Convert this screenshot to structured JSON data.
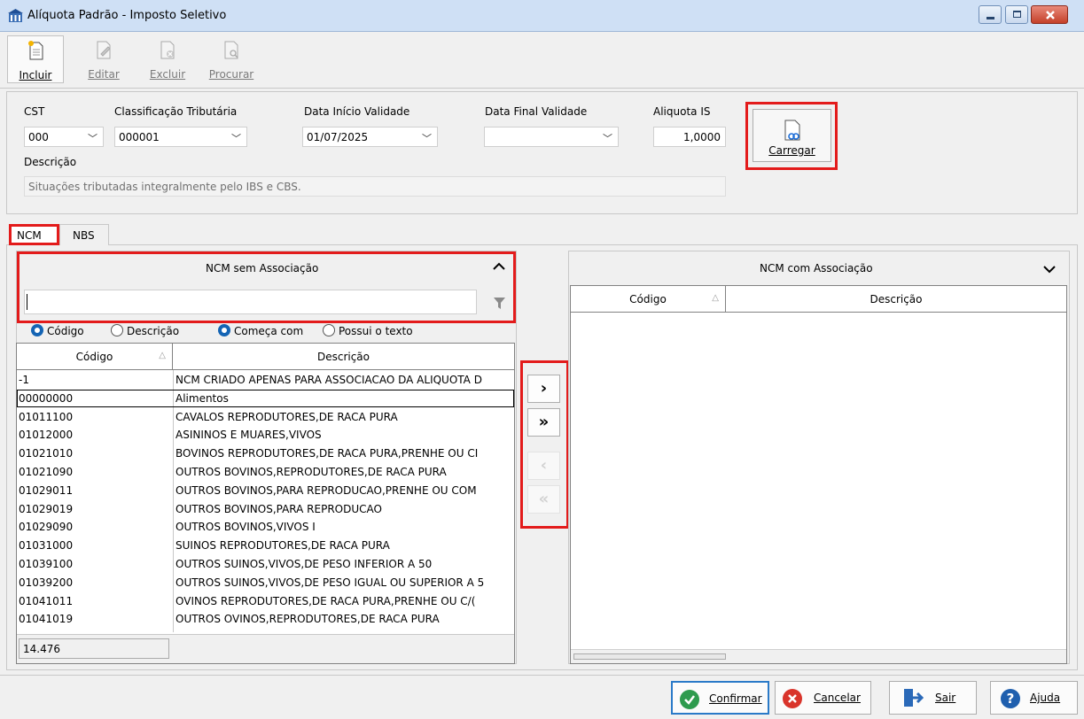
{
  "window": {
    "title": "Alíquota Padrão - Imposto Seletivo"
  },
  "toolbar": {
    "incluir": "Incluir",
    "editar": "Editar",
    "excluir": "Excluir",
    "procurar": "Procurar"
  },
  "form": {
    "cst_label": "CST",
    "cst_value": "000",
    "class_label": "Classificação Tributária",
    "class_value": "000001",
    "data_inicio_label": "Data Início Validade",
    "data_inicio_value": "01/07/2025",
    "data_final_label": "Data Final Validade",
    "data_final_value": "",
    "aliquota_label": "Aliquota IS",
    "aliquota_value": "1,0000",
    "descricao_label": "Descrição",
    "descricao_value": "Situações tributadas integralmente pelo IBS e CBS.",
    "carregar_label": "Carregar"
  },
  "tabs": [
    "NCM",
    "NBS"
  ],
  "left_panel": {
    "title": "NCM sem Associação",
    "search_value": "",
    "radio_codigo": "Código",
    "radio_descricao": "Descrição",
    "radio_comeca": "Começa com",
    "radio_possui": "Possui o texto",
    "col_codigo": "Código",
    "col_descricao": "Descrição",
    "rows": [
      {
        "codigo": "-1",
        "descricao": "NCM CRIADO APENAS PARA ASSOCIACAO DA ALIQUOTA D"
      },
      {
        "codigo": "00000000",
        "descricao": "Alimentos"
      },
      {
        "codigo": "01011100",
        "descricao": "CAVALOS REPRODUTORES,DE RACA PURA"
      },
      {
        "codigo": "01012000",
        "descricao": "ASININOS E MUARES,VIVOS"
      },
      {
        "codigo": "01021010",
        "descricao": "BOVINOS REPRODUTORES,DE RACA PURA,PRENHE OU CI"
      },
      {
        "codigo": "01021090",
        "descricao": "OUTROS BOVINOS,REPRODUTORES,DE RACA PURA"
      },
      {
        "codigo": "01029011",
        "descricao": "OUTROS BOVINOS,PARA REPRODUCAO,PRENHE OU COM"
      },
      {
        "codigo": "01029019",
        "descricao": "OUTROS BOVINOS,PARA REPRODUCAO"
      },
      {
        "codigo": "01029090",
        "descricao": "OUTROS BOVINOS,VIVOS I"
      },
      {
        "codigo": "01031000",
        "descricao": "SUINOS REPRODUTORES,DE RACA PURA"
      },
      {
        "codigo": "01039100",
        "descricao": "OUTROS SUINOS,VIVOS,DE PESO INFERIOR A 50"
      },
      {
        "codigo": "01039200",
        "descricao": "OUTROS SUINOS,VIVOS,DE PESO IGUAL OU SUPERIOR A 5"
      },
      {
        "codigo": "01041011",
        "descricao": "OVINOS REPRODUTORES,DE RACA PURA,PRENHE OU C/("
      },
      {
        "codigo": "01041019",
        "descricao": "OUTROS OVINOS,REPRODUTORES,DE RACA PURA"
      }
    ],
    "count": "14.476"
  },
  "right_panel": {
    "title": "NCM com Associação",
    "col_codigo": "Código",
    "col_descricao": "Descrição"
  },
  "transfer": {
    "add_one": "›",
    "add_all": "»",
    "remove_one": "‹",
    "remove_all": "«"
  },
  "footer": {
    "confirmar": "Confirmar",
    "cancelar": "Cancelar",
    "sair": "Sair",
    "ajuda": "Ajuda"
  },
  "colors": {
    "highlight_red": "#e31b1b",
    "radio_blue": "#1464b4",
    "confirm_green": "#2e9b4e",
    "cancel_red": "#d9342b",
    "help_blue": "#1f5fae"
  },
  "icons": [
    "app-icon",
    "new-doc-icon",
    "edit-doc-icon",
    "delete-doc-icon",
    "search-doc-icon",
    "link-doc-icon",
    "filter-icon",
    "chevron-up-icon",
    "chevron-down-icon",
    "check-icon",
    "x-icon",
    "exit-icon",
    "help-icon"
  ]
}
